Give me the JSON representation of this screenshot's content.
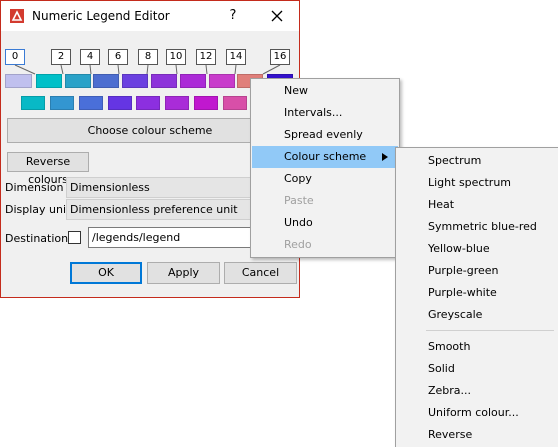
{
  "window": {
    "title": "Numeric Legend Editor",
    "help": "?"
  },
  "legend": {
    "ticks": [
      "0",
      "2",
      "4",
      "6",
      "8",
      "10",
      "12",
      "14",
      "16"
    ],
    "top_colors": [
      "#c0c0ee",
      "#00c0c8",
      "#2aa2c8",
      "#4d6ed0",
      "#6a40e0",
      "#8d33da",
      "#ab2ad7",
      "#c83bcb",
      "#e07f7a",
      "#3311cc"
    ],
    "bottom_colors": [
      "#08b9c6",
      "#3396d1",
      "#4a6fd9",
      "#6535e3",
      "#8c2fe0",
      "#a92cd8",
      "#c018cf",
      "#d84fa8"
    ]
  },
  "buttons": {
    "choose_scheme": "Choose colour scheme",
    "reverse": "Reverse colours",
    "ok": "OK",
    "apply": "Apply",
    "cancel": "Cancel"
  },
  "fields": {
    "dimension_label": "Dimension",
    "dimension_value": "Dimensionless",
    "unit_label": "Display unit",
    "unit_value": "Dimensionless preference unit",
    "destination_label": "Destination",
    "destination_value": "/legends/legend"
  },
  "context_menu": [
    {
      "label": "New",
      "enabled": true
    },
    {
      "label": "Intervals...",
      "enabled": true
    },
    {
      "label": "Spread evenly",
      "enabled": true
    },
    {
      "label": "Colour scheme",
      "enabled": true,
      "submenu": true,
      "highlighted": true
    },
    {
      "label": "Copy",
      "enabled": true
    },
    {
      "label": "Paste",
      "enabled": false
    },
    {
      "label": "Undo",
      "enabled": true
    },
    {
      "label": "Redo",
      "enabled": false
    }
  ],
  "submenu": {
    "schemes": [
      "Spectrum",
      "Light spectrum",
      "Heat",
      "Symmetric blue-red",
      "Yellow-blue",
      "Purple-green",
      "Purple-white",
      "Greyscale"
    ],
    "styles": [
      "Smooth",
      "Solid",
      "Zebra...",
      "Uniform colour...",
      "Reverse"
    ]
  },
  "colors": {
    "highlight": "#91c9f7",
    "window_border": "#c42b1c",
    "app_icon": "#d33b2f"
  }
}
